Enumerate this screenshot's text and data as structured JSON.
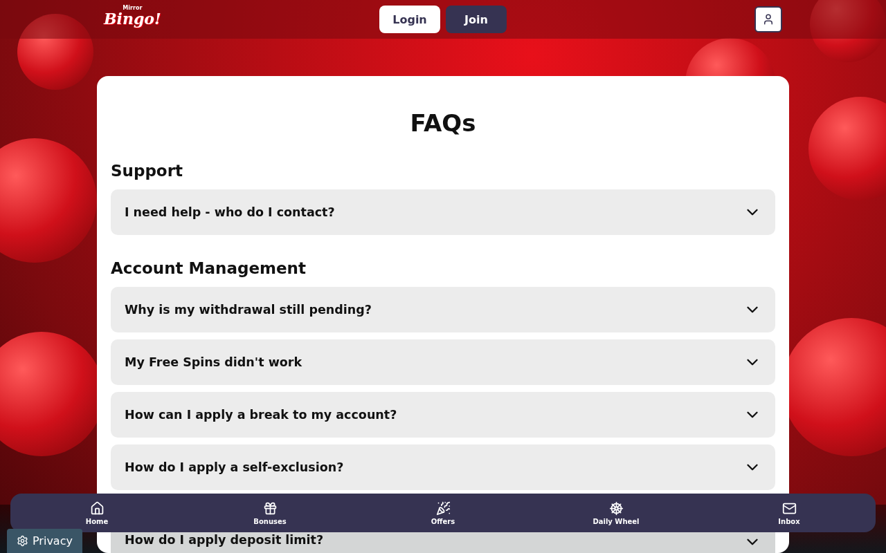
{
  "header": {
    "logo_small": "Mirror",
    "logo_main": "Bingo!",
    "buttons": [
      {
        "label": "Login",
        "kind": "light"
      },
      {
        "label": "Join",
        "kind": "dark"
      }
    ]
  },
  "page": {
    "title": "FAQs",
    "sections": [
      {
        "heading": "Support",
        "questions": [
          {
            "text": "I need help - who do I contact?"
          }
        ]
      },
      {
        "heading": "Account Management",
        "questions": [
          {
            "text": "Why is my withdrawal still pending?"
          },
          {
            "text": "My Free Spins didn't work"
          },
          {
            "text": "How can I apply a break to my account?"
          },
          {
            "text": "How do I apply a self-exclusion?"
          },
          {
            "text": "How do I apply deposit limit?"
          }
        ]
      }
    ]
  },
  "bottom_nav": [
    {
      "label": "Home",
      "kind": "home"
    },
    {
      "label": "Bonuses",
      "kind": "gift"
    },
    {
      "label": "Offers",
      "kind": "party"
    },
    {
      "label": "Daily Wheel",
      "kind": "wheel"
    },
    {
      "label": "Inbox",
      "kind": "mail"
    }
  ],
  "privacy_button": {
    "label": "Privacy"
  }
}
